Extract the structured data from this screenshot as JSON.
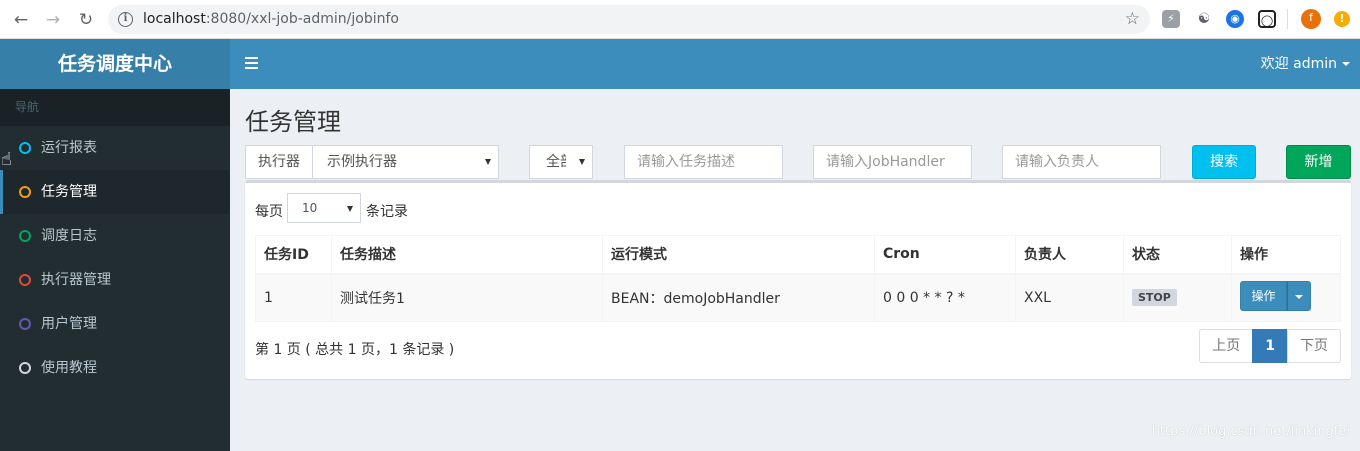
{
  "browser": {
    "url_host": "localhost",
    "url_path": ":8080/xxl-job-admin/jobinfo",
    "profile_letter": "f"
  },
  "sidebar": {
    "logo": "任务调度中心",
    "nav_header": "导航",
    "items": [
      {
        "label": "运行报表",
        "color": "#00c0ef"
      },
      {
        "label": "任务管理",
        "color": "#f39c12"
      },
      {
        "label": "调度日志",
        "color": "#00a65a"
      },
      {
        "label": "执行器管理",
        "color": "#dd4b39"
      },
      {
        "label": "用户管理",
        "color": "#605ca8"
      },
      {
        "label": "使用教程",
        "color": "#d2d6de"
      }
    ]
  },
  "navbar": {
    "user": "欢迎 admin"
  },
  "page": {
    "title": "任务管理"
  },
  "filters": {
    "executor_label": "执行器",
    "executor_value": "示例执行器",
    "status_value": "全部",
    "job_desc_placeholder": "请输入任务描述",
    "handler_placeholder": "请输入JobHandler",
    "author_placeholder": "请输入负责人",
    "search_label": "搜索",
    "add_label": "新增"
  },
  "table": {
    "length_prefix": "每页",
    "length_value": "10",
    "length_suffix": "条记录",
    "columns": [
      "任务ID",
      "任务描述",
      "运行模式",
      "Cron",
      "负责人",
      "状态",
      "操作"
    ],
    "rows": [
      {
        "id": "1",
        "desc": "测试任务1",
        "mode": "BEAN：demoJobHandler",
        "cron": "0 0 0 * * ? *",
        "author": "XXL",
        "status": "STOP",
        "action": "操作"
      }
    ],
    "info": "第 1 页 ( 总共 1 页，1 条记录 )",
    "pagination": {
      "prev": "上页",
      "current": "1",
      "next": "下页"
    }
  },
  "watermark": "https://blog.csdn.net/linkingfei"
}
